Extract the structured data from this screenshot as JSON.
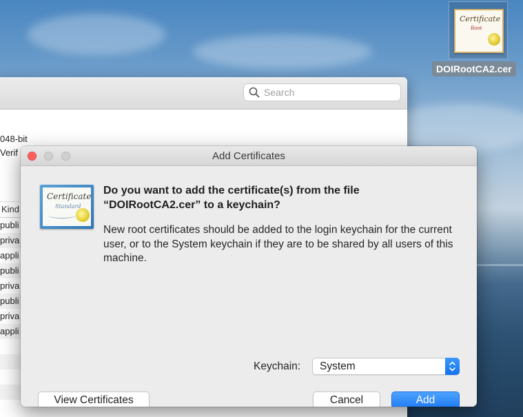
{
  "desktop": {
    "file_icon": {
      "name": "DOIRootCA2.cer",
      "paper_title": "Certificate",
      "paper_subtitle": "Root"
    }
  },
  "background_window": {
    "search_placeholder": "Search",
    "info_lines": [
      "048-bit",
      "Verif"
    ],
    "column_header": "Kind",
    "rows": [
      "publi",
      "priva",
      "appli",
      "publi",
      "priva",
      "publi",
      "priva",
      "appli"
    ]
  },
  "dialog": {
    "title": "Add Certificates",
    "icon": {
      "title": "Certificate",
      "subtitle": "Standard"
    },
    "headline_line1": "Do you want to add the certificate(s) from the file",
    "headline_line2": "“DOIRootCA2.cer” to a keychain?",
    "body": "New root certificates should be added to the login keychain for the current user, or to the System keychain if they are to be shared by all users of this machine.",
    "keychain_label": "Keychain:",
    "keychain_value": "System",
    "buttons": {
      "view_certificates": "View Certificates",
      "cancel": "Cancel",
      "add": "Add"
    },
    "colors": {
      "close": "#fc605c",
      "accent": "#1f7bf3"
    }
  }
}
